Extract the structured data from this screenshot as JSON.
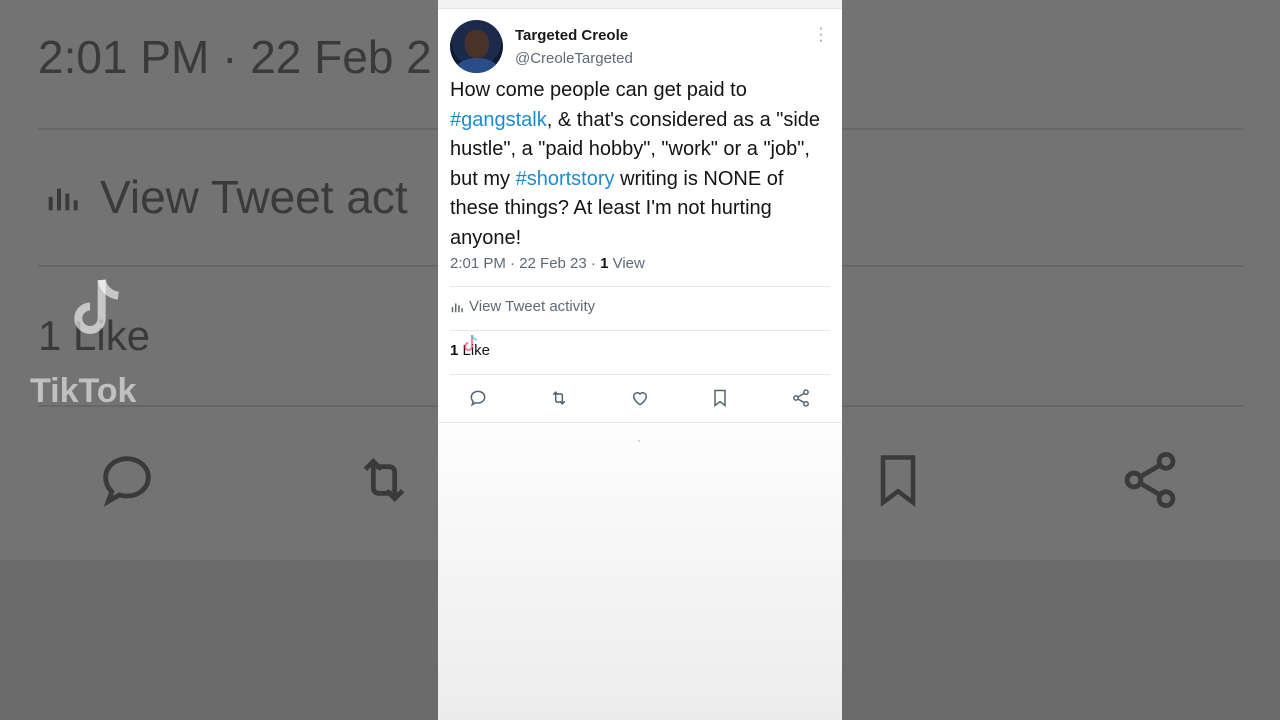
{
  "tweet": {
    "display_name": "Targeted Creole",
    "handle": "@CreoleTargeted",
    "text_parts": [
      {
        "text": "How come people can get paid to ",
        "tag": false
      },
      {
        "text": "#gangstalk",
        "tag": true
      },
      {
        "text": ", & that's considered as a \"side hustle\", a \"paid hobby\", \"work\" or a \"job\", but my ",
        "tag": false
      },
      {
        "text": "#shortstory",
        "tag": true
      },
      {
        "text": " writing is NONE of these things? At least I'm not hurting anyone!",
        "tag": false
      }
    ],
    "timestamp": "2:01 PM · 22 Feb 23 · ",
    "view_count": "1",
    "view_label": " View",
    "activity_label": "View Tweet activity",
    "like_count": "1",
    "like_label": " Like"
  },
  "backdrop": {
    "time": "2:01 PM · 22 Feb 2",
    "activity": "View Tweet act",
    "like": "1 Like"
  },
  "actions": [
    {
      "name": "reply",
      "icon": "reply-icon"
    },
    {
      "name": "retweet",
      "icon": "retweet-icon"
    },
    {
      "name": "like",
      "icon": "heart-icon"
    },
    {
      "name": "bookmark",
      "icon": "bookmark-icon"
    },
    {
      "name": "share",
      "icon": "share-icon"
    }
  ],
  "watermark": "TikTok",
  "colors": {
    "accent": "#1d8bd1",
    "muted": "#5e6a75",
    "text": "#141414"
  }
}
